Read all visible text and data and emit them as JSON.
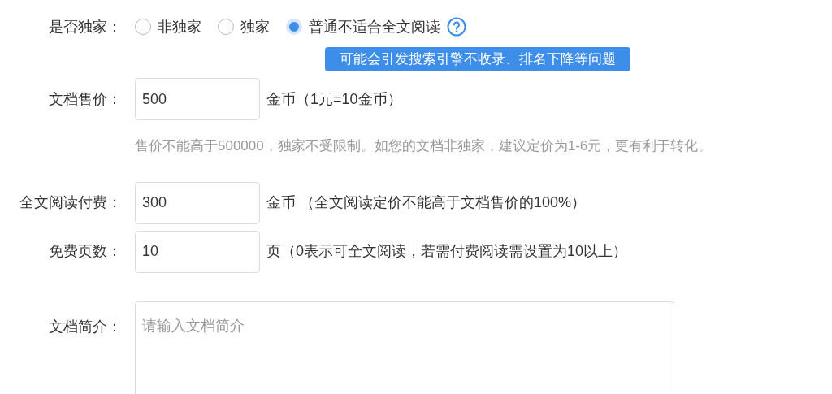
{
  "fields": [
    {
      "kind": "radio",
      "label": "是否独家：",
      "options": [
        {
          "label": "非独家",
          "selected": false
        },
        {
          "label": "独家",
          "selected": false
        },
        {
          "label": "普通不适合全文阅读",
          "selected": true
        }
      ],
      "tooltip": "可能会引发搜索引擎不收录、排名下降等问题"
    },
    {
      "kind": "input",
      "label": "文档售价：",
      "value": "500",
      "suffix": "金币（1元=10金币）",
      "hint": "售价不能高于500000，独家不受限制。如您的文档非独家，建议定价为1-6元，更有利于转化。"
    },
    {
      "kind": "input",
      "label": "全文阅读付费：",
      "value": "300",
      "suffix": "金币 （全文阅读定价不能高于文档售价的100%）"
    },
    {
      "kind": "input",
      "label": "免费页数：",
      "value": "10",
      "suffix": "页（0表示可全文阅读，若需付费阅读需设置为10以上）"
    },
    {
      "kind": "textarea",
      "label": "文档简介：",
      "placeholder": "请输入文档简介"
    }
  ]
}
